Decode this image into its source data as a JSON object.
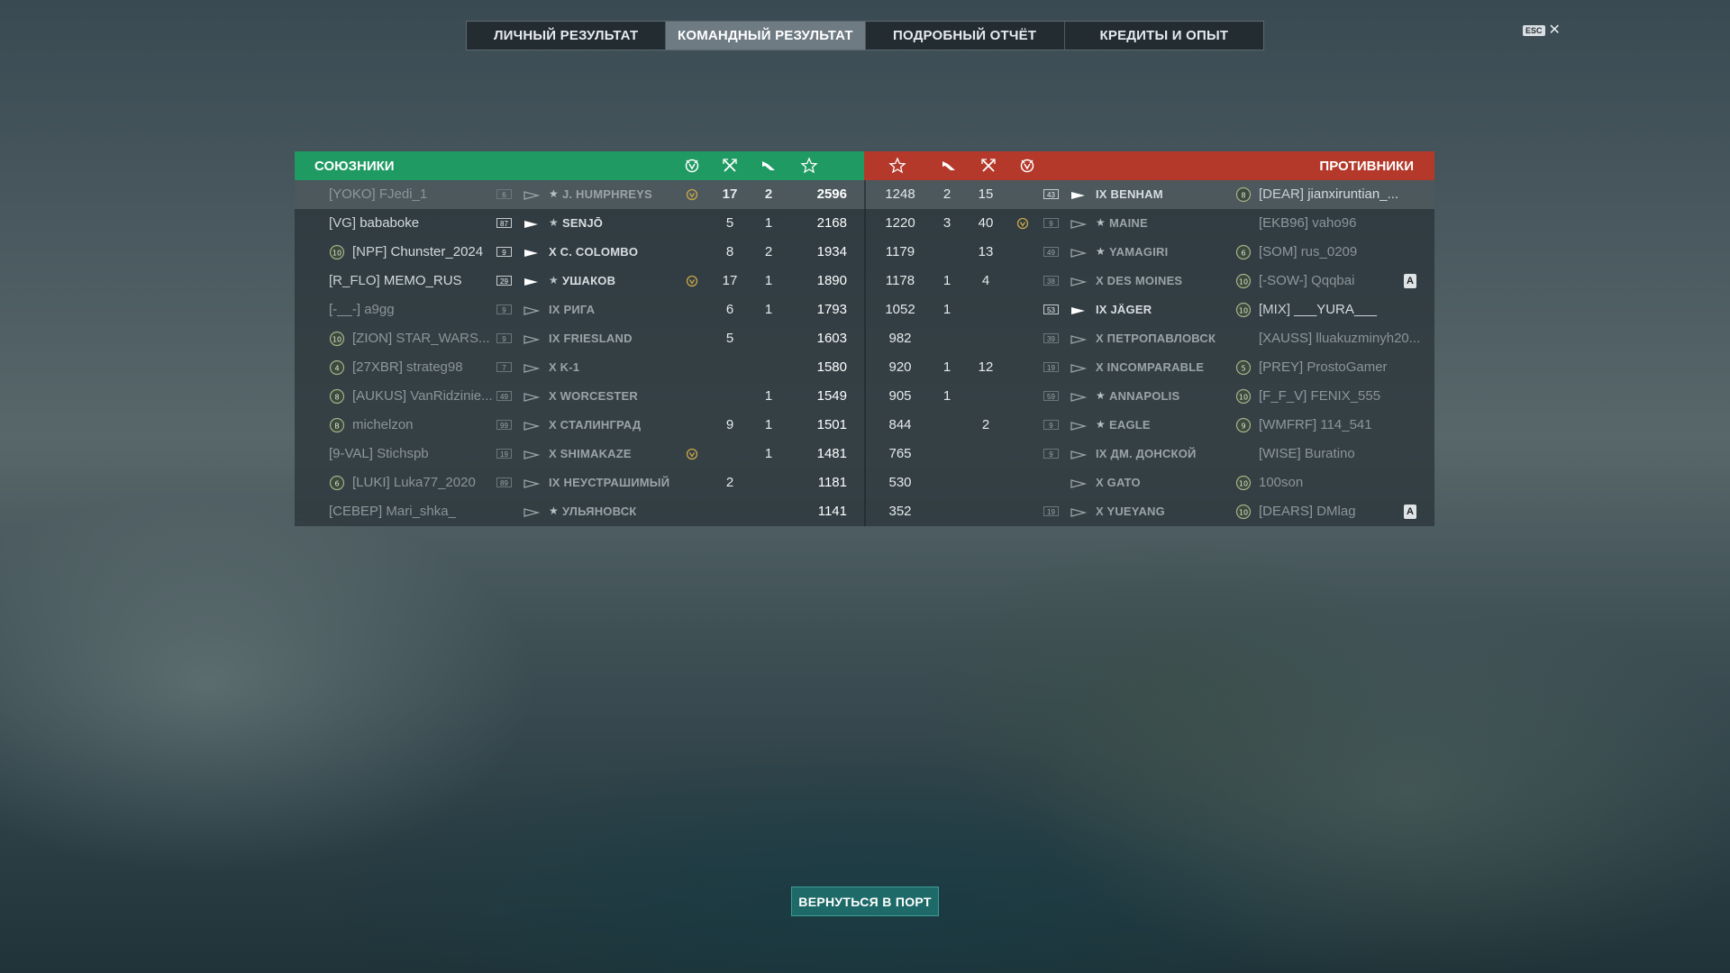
{
  "tabs": [
    "ЛИЧНЫЙ РЕЗУЛЬТАТ",
    "КОМАНДНЫЙ РЕЗУЛЬТАТ",
    "ПОДРОБНЫЙ ОТЧЁТ",
    "КРЕДИТЫ И ОПЫТ"
  ],
  "active_tab": 1,
  "esc_label": "ESC",
  "allies_title": "СОЮЗНИКИ",
  "enemies_title": "ПРОТИВНИКИ",
  "return_button": "ВЕРНУТЬСЯ В ПОРТ",
  "colors": {
    "allies": "#1f9a62",
    "enemies": "#b4392b",
    "button": "#1e6a68"
  },
  "allies": [
    {
      "clan": "[YOKO]",
      "name": "FJedi_1",
      "level": "6",
      "ship": "J. HUMPHREYS",
      "ship_star": true,
      "medal": true,
      "frags": "17",
      "planes": "2",
      "xp": "2596",
      "dim": true,
      "highlight": true
    },
    {
      "clan": "[VG]",
      "name": "bababoke",
      "level": "87",
      "ship": "SENJŌ",
      "ship_star": true,
      "medal": false,
      "frags": "5",
      "planes": "1",
      "xp": "2168",
      "dim": false
    },
    {
      "clan": "[NPF]",
      "name": "Chunster_2024",
      "level": "9",
      "ship": "X C. COLOMBO",
      "ship_star": false,
      "medal": false,
      "frags": "8",
      "planes": "2",
      "xp": "1934",
      "dim": false,
      "badge": "10"
    },
    {
      "clan": "[R_FLO]",
      "name": "MEMO_RUS",
      "level": "29",
      "ship": "УШАКОВ",
      "ship_star": true,
      "medal": true,
      "frags": "17",
      "planes": "1",
      "xp": "1890",
      "dim": false
    },
    {
      "clan": "[-__-]",
      "name": "a9gg",
      "level": "9",
      "ship": "IX РИГА",
      "ship_star": false,
      "medal": false,
      "frags": "6",
      "planes": "1",
      "xp": "1793",
      "dim": true
    },
    {
      "clan": "[ZION]",
      "name": "STAR_WARS...",
      "level": "9",
      "ship": "IX FRIESLAND",
      "ship_star": false,
      "medal": false,
      "frags": "5",
      "planes": "",
      "xp": "1603",
      "dim": true,
      "badge": "10"
    },
    {
      "clan": "[27XBR]",
      "name": "strateg98",
      "level": "7",
      "ship": "X K-1",
      "ship_star": false,
      "medal": false,
      "frags": "",
      "planes": "",
      "xp": "1580",
      "dim": true,
      "badge": "4"
    },
    {
      "clan": "[AUKUS]",
      "name": "VanRidzinie...",
      "level": "49",
      "ship": "X WORCESTER",
      "ship_star": false,
      "medal": false,
      "frags": "",
      "planes": "1",
      "xp": "1549",
      "dim": true,
      "badge": "8"
    },
    {
      "clan": "",
      "name": "michelzon",
      "level": "99",
      "ship": "X СТАЛИНГРАД",
      "ship_star": false,
      "medal": false,
      "frags": "9",
      "planes": "1",
      "xp": "1501",
      "dim": true,
      "badge": "B"
    },
    {
      "clan": "[9-VAL]",
      "name": "Stichspb",
      "level": "19",
      "ship": "X SHIMAKAZE",
      "ship_star": false,
      "medal": true,
      "frags": "",
      "planes": "1",
      "xp": "1481",
      "dim": true
    },
    {
      "clan": "[LUKI]",
      "name": "Luka77_2020",
      "level": "89",
      "ship": "IX НЕУСТРАШИМЫЙ",
      "ship_star": false,
      "medal": false,
      "frags": "2",
      "planes": "",
      "xp": "1181",
      "dim": true,
      "badge": "6"
    },
    {
      "clan": "[CEBEP]",
      "name": "Mari_shka_",
      "level": "",
      "ship": "УЛЬЯНОВСК",
      "ship_star": true,
      "medal": false,
      "frags": "",
      "planes": "",
      "xp": "1141",
      "dim": true
    }
  ],
  "enemies": [
    {
      "xp": "1248",
      "planes": "2",
      "frags": "15",
      "medal": false,
      "level": "43",
      "ship": "IX BENHAM",
      "ship_star": false,
      "clan": "[DEAR]",
      "name": "jianxiruntian_...",
      "dim": false,
      "badge": "8",
      "highlight": true
    },
    {
      "xp": "1220",
      "planes": "3",
      "frags": "40",
      "medal": true,
      "level": "9",
      "ship": "MAINE",
      "ship_star": true,
      "clan": "[EKB96]",
      "name": "vaho96",
      "dim": true
    },
    {
      "xp": "1179",
      "planes": "",
      "frags": "13",
      "medal": false,
      "level": "49",
      "ship": "YAMAGIRI",
      "ship_star": true,
      "clan": "[SOM]",
      "name": "rus_0209",
      "dim": true,
      "badge": "6"
    },
    {
      "xp": "1178",
      "planes": "1",
      "frags": "4",
      "medal": false,
      "level": "38",
      "ship": "X DES MOINES",
      "ship_star": false,
      "clan": "[-SOW-]",
      "name": "Qqqbai",
      "dim": true,
      "badge": "10",
      "mark": "A"
    },
    {
      "xp": "1052",
      "planes": "1",
      "frags": "",
      "medal": false,
      "level": "53",
      "ship": "IX JÄGER",
      "ship_star": false,
      "clan": "[MIX]",
      "name": "___YURA___",
      "dim": false,
      "badge": "10"
    },
    {
      "xp": "982",
      "planes": "",
      "frags": "",
      "medal": false,
      "level": "39",
      "ship": "X ПЕТРОПАВЛОВСК",
      "ship_star": false,
      "clan": "[XAUSS]",
      "name": "lluakuzminyh20...",
      "dim": true
    },
    {
      "xp": "920",
      "planes": "1",
      "frags": "12",
      "medal": false,
      "level": "19",
      "ship": "X INCOMPARABLE",
      "ship_star": false,
      "clan": "[PREY]",
      "name": "ProstoGamer",
      "dim": true,
      "badge": "5"
    },
    {
      "xp": "905",
      "planes": "1",
      "frags": "",
      "medal": false,
      "level": "59",
      "ship": "ANNAPOLIS",
      "ship_star": true,
      "clan": "[F_F_V]",
      "name": "FENIX_555",
      "dim": true,
      "badge": "10"
    },
    {
      "xp": "844",
      "planes": "",
      "frags": "2",
      "medal": false,
      "level": "9",
      "ship": "EAGLE",
      "ship_star": true,
      "clan": "[WMFRF]",
      "name": "114_541",
      "dim": true,
      "badge": "9"
    },
    {
      "xp": "765",
      "planes": "",
      "frags": "",
      "medal": false,
      "level": "9",
      "ship": "IX ДМ. ДОНСКОЙ",
      "ship_star": false,
      "clan": "[WISE]",
      "name": "Buratino",
      "dim": true
    },
    {
      "xp": "530",
      "planes": "",
      "frags": "",
      "medal": false,
      "level": "",
      "ship": "X GATO",
      "ship_star": false,
      "clan": "",
      "name": "100son",
      "dim": true,
      "badge": "10"
    },
    {
      "xp": "352",
      "planes": "",
      "frags": "",
      "medal": false,
      "level": "19",
      "ship": "X YUEYANG",
      "ship_star": false,
      "clan": "[DEARS]",
      "name": "DMlag",
      "dim": true,
      "badge": "10",
      "mark": "A"
    }
  ]
}
